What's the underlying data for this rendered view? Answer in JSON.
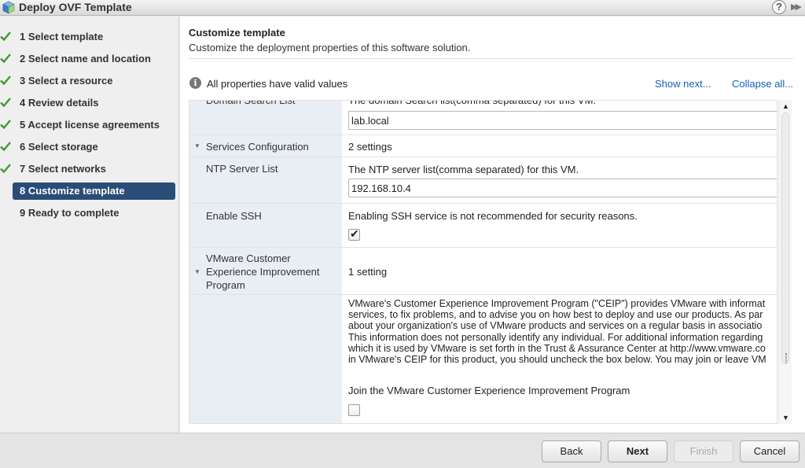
{
  "window": {
    "title": "Deploy OVF Template",
    "help_label": "?",
    "expand_label": "▶▶"
  },
  "steps": [
    {
      "label": "1  Select template",
      "done": true
    },
    {
      "label": "2  Select name and location",
      "done": true
    },
    {
      "label": "3  Select a resource",
      "done": true
    },
    {
      "label": "4  Review details",
      "done": true
    },
    {
      "label": "5  Accept license agreements",
      "done": true
    },
    {
      "label": "6  Select storage",
      "done": true
    },
    {
      "label": "7  Select networks",
      "done": true
    },
    {
      "label": "8  Customize template",
      "active": true
    },
    {
      "label": "9  Ready to complete"
    }
  ],
  "header": {
    "title": "Customize template",
    "subtitle": "Customize the deployment properties of this software solution."
  },
  "status": {
    "text": "All properties have valid values",
    "show_next": "Show next...",
    "collapse_all": "Collapse all..."
  },
  "properties": {
    "domain_search": {
      "label": "Domain Search List",
      "description": "The domain Search list(comma separated) for this VM.",
      "value": "lab.local"
    },
    "services": {
      "label": "Services Configuration",
      "summary": "2 settings"
    },
    "ntp": {
      "label": "NTP Server List",
      "description": "The NTP server list(comma separated) for this VM.",
      "value": "192.168.10.4"
    },
    "ssh": {
      "label": "Enable SSH",
      "description": "Enabling SSH service is not recommended for security reasons.",
      "checked": true
    },
    "ceip": {
      "label_1": "VMware Customer",
      "label_2": "Experience Improvement",
      "label_3": "Program",
      "summary": "1 setting",
      "lines": [
        "VMware's Customer Experience Improvement Program (\"CEIP\") provides VMware with informat",
        "services, to fix problems, and to advise you on how best to deploy and use our products.  As par",
        "about your organization's use of VMware products and services on a regular basis in associatio",
        "This information does not personally identify any individual. For additional information regarding",
        "which it is used by VMware is set forth in the Trust & Assurance Center at http://www.vmware.co",
        "in VMware's CEIP for this product, you should uncheck the box below. You may join or leave VM"
      ],
      "join_label": "Join the VMware Customer Experience Improvement Program",
      "checked": false
    }
  },
  "buttons": {
    "back": "Back",
    "next": "Next",
    "finish": "Finish",
    "cancel": "Cancel"
  },
  "colors": {
    "active_step": "#2a4d78",
    "check": "#3f9a2c",
    "link": "#1560b8",
    "label_cell": "#e9eef5"
  }
}
